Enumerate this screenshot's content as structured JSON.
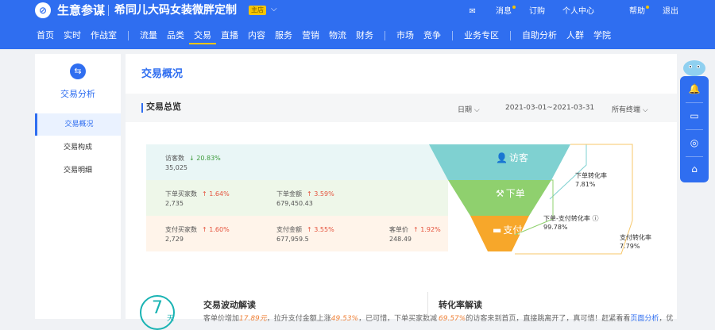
{
  "app": {
    "logo_glyph": "⊘",
    "brand": "生意参谋",
    "shop_name": "希同儿大码女装微胖定制",
    "shop_badge": "主店",
    "caret": "⌵"
  },
  "top_links": [
    "消息",
    "订购",
    "个人中心",
    "帮助",
    "退出"
  ],
  "nav": {
    "group1": [
      "首页",
      "实时",
      "作战室"
    ],
    "group2": [
      "流量",
      "品类",
      "交易",
      "直播",
      "内容",
      "服务",
      "营销",
      "物流",
      "财务"
    ],
    "group3": [
      "市场",
      "竞争"
    ],
    "group4": [
      "业务专区"
    ],
    "group5": [
      "自助分析",
      "人群",
      "学院"
    ],
    "active": "交易"
  },
  "sidebar": {
    "title": "交易分析",
    "items": [
      "交易概况",
      "交易构成",
      "交易明细"
    ],
    "active_index": 0
  },
  "main": {
    "page_title": "交易概况",
    "section_title": "交易总览",
    "date_label": "日期",
    "date_range": "2021-03-01~2021-03-31",
    "terminal": "所有终端"
  },
  "funnel": {
    "stages": [
      {
        "name": "访客",
        "icon": "user-icon",
        "color": "#7fd1d1"
      },
      {
        "name": "下单",
        "icon": "hammer-icon",
        "color": "#8fd06e"
      },
      {
        "name": "支付",
        "icon": "card-icon",
        "color": "#f7a72a"
      }
    ],
    "metrics": {
      "visitors": {
        "label": "访客数",
        "change": "20.83%",
        "direction": "down",
        "value": "35,025"
      },
      "order_buyers": {
        "label": "下单买家数",
        "change": "1.64%",
        "direction": "up",
        "value": "2,735"
      },
      "order_amount": {
        "label": "下单金额",
        "change": "3.59%",
        "direction": "up",
        "value": "679,450.43"
      },
      "pay_buyers": {
        "label": "支付买家数",
        "change": "1.60%",
        "direction": "up",
        "value": "2,729"
      },
      "pay_amount": {
        "label": "支付金额",
        "change": "3.55%",
        "direction": "up",
        "value": "677,959.5"
      },
      "avg_price": {
        "label": "客单价",
        "change": "1.92%",
        "direction": "up",
        "value": "248.49"
      }
    },
    "rates": {
      "order_rate": {
        "label": "下单转化率",
        "value": "7.81%"
      },
      "order_pay_rate": {
        "label": "下单-支付转化率",
        "value": "99.78%"
      },
      "pay_rate": {
        "label": "支付转化率",
        "value": "7.79%"
      }
    }
  },
  "interpretation": {
    "days_number": "7",
    "days_unit": "天",
    "wave_title": "交易波动解读",
    "wave_text_pre": "客单价增加",
    "wave_hl1": "17.89元",
    "wave_text_mid": "，拉升支付金额上涨",
    "wave_hl2": "49.53%",
    "wave_text_post": "，已可惜，下单买家数减",
    "conv_title": "转化率解读",
    "conv_hl": "69.57%",
    "conv_text": "的访客来到首页，直接跳离开了，真可惜！赶紧看看",
    "conv_link": "页面分析",
    "conv_tail": "，优"
  },
  "float_tools": [
    "bell-icon",
    "chat-icon",
    "target-icon",
    "home-icon"
  ]
}
